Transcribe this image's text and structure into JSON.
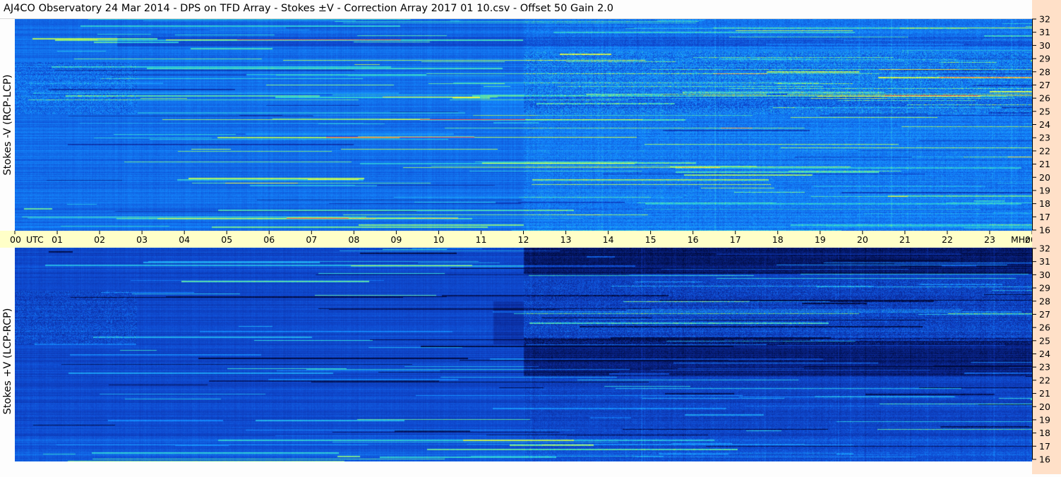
{
  "title": "AJ4CO Observatory  24 Mar 2014  -  DPS on TFD Array  -  Stokes ±V  -  Correction Array 2017 01 10.csv  -  Offset 50  Gain 2.0",
  "colors": {
    "background": "#fdfdfd",
    "time_axis_band": "#ffffc8",
    "freq_axis_band": "#ffe0c8",
    "colormap": [
      "#000a3c",
      "#0a2896",
      "#0f4bd2",
      "#148cff",
      "#32d2d2",
      "#b4f05a",
      "#ffff3c",
      "#ff5050"
    ]
  },
  "chart_data": [
    {
      "type": "heatmap",
      "ylabel": "Stokes -V (RCP-LCP)",
      "x_ticks": [
        "00",
        "01",
        "02",
        "03",
        "04",
        "05",
        "06",
        "07",
        "08",
        "09",
        "10",
        "11",
        "12",
        "13",
        "14",
        "15",
        "16",
        "17",
        "18",
        "19",
        "20",
        "21",
        "22",
        "23",
        "00"
      ],
      "x_unit": "UTC",
      "y_ticks": [
        "16",
        "17",
        "18",
        "19",
        "20",
        "21",
        "22",
        "23",
        "24",
        "25",
        "26",
        "27",
        "28",
        "29",
        "30",
        "31",
        "32"
      ],
      "y_unit": "MHz",
      "xlim": [
        0,
        24
      ],
      "ylim": [
        16,
        32
      ]
    },
    {
      "type": "heatmap",
      "ylabel": "Stokes +V (LCP-RCP)",
      "x_ticks": [
        "00",
        "01",
        "02",
        "03",
        "04",
        "05",
        "06",
        "07",
        "08",
        "09",
        "10",
        "11",
        "12",
        "13",
        "14",
        "15",
        "16",
        "17",
        "18",
        "19",
        "20",
        "21",
        "22",
        "23",
        "00"
      ],
      "x_unit": "UTC",
      "y_ticks": [
        "16",
        "17",
        "18",
        "19",
        "20",
        "21",
        "22",
        "23",
        "24",
        "25",
        "26",
        "27",
        "28",
        "29",
        "30",
        "31",
        "32"
      ],
      "y_unit": "MHz",
      "xlim": [
        0,
        24
      ],
      "ylim": [
        16,
        32
      ]
    }
  ]
}
